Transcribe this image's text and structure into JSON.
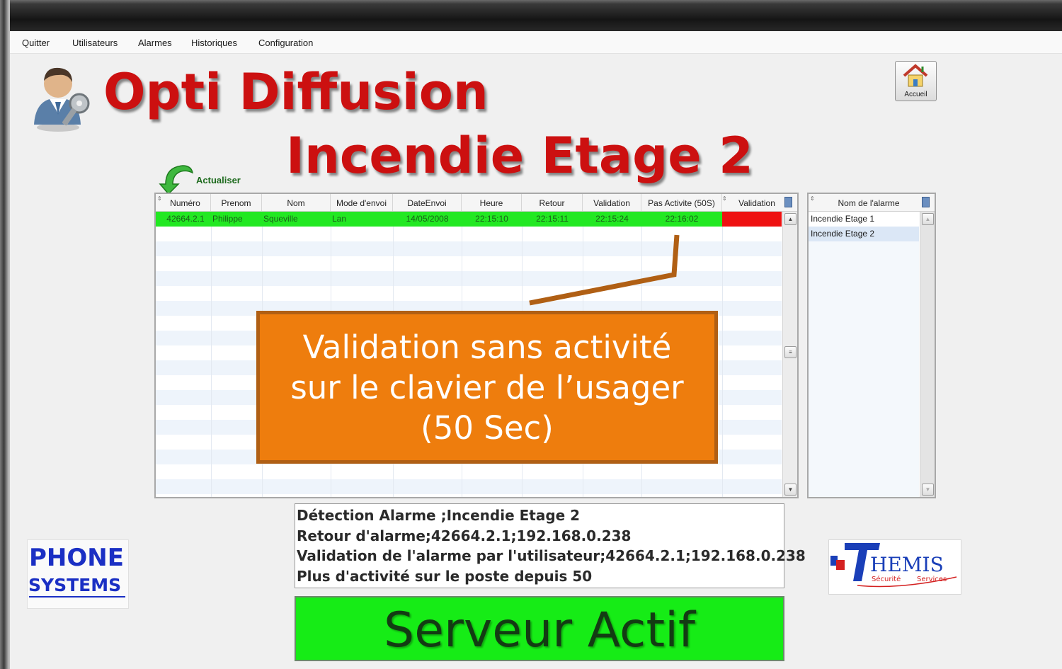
{
  "menu": {
    "items": [
      {
        "label": "Quitter"
      },
      {
        "label": "Utilisateurs"
      },
      {
        "label": "Alarmes"
      },
      {
        "label": "Historiques"
      },
      {
        "label": "Configuration"
      }
    ]
  },
  "header": {
    "app_title": "Opti Diffusion",
    "alarm_title": "Incendie Etage 2",
    "home_label": "Accueil",
    "refresh_label": "Actualiser"
  },
  "grid": {
    "columns": [
      "Numéro",
      "Prenom",
      "Nom",
      "Mode d'envoi",
      "DateEnvoi",
      "Heure",
      "Retour",
      "Validation",
      "Pas Activite (50S)",
      "Validation"
    ],
    "rows": [
      [
        "42664.2.1",
        "Philippe",
        "Squeville",
        "Lan",
        "14/05/2008",
        "22:15:10",
        "22:15:11",
        "22:15:24",
        "22:16:02",
        ""
      ]
    ],
    "row_color": "#22e822",
    "alert_color": "#ee1111"
  },
  "alarm_list": {
    "header": "Nom de l'alarme",
    "items": [
      {
        "label": "Incendie Etage 1",
        "selected": false
      },
      {
        "label": "Incendie Etage 2",
        "selected": true
      }
    ]
  },
  "callout": {
    "lines": [
      "Validation sans activité",
      "sur le clavier de l’usager",
      "(50 Sec)"
    ],
    "color": "#ee7d0d"
  },
  "log": {
    "lines": [
      "Détection Alarme ;Incendie Etage 2",
      "Retour d'alarme;42664.2.1;192.168.0.238",
      "Validation de l'alarme par l'utilisateur;42664.2.1;192.168.0.238",
      "Plus d'activité sur le poste depuis 50"
    ]
  },
  "status": {
    "label": "Serveur Actif",
    "color": "#16ec16"
  },
  "logos": {
    "phone_systems": [
      "PHONE",
      "SYSTEMS"
    ],
    "themis": {
      "name": "THEMIS",
      "tagline": "Sécurité",
      "tagline2": "Services"
    }
  }
}
